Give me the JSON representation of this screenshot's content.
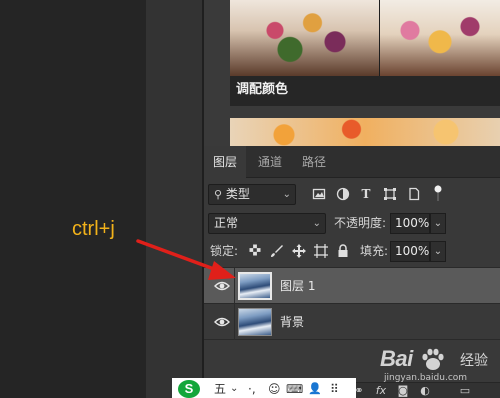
{
  "learn_panel": {
    "card_title": "调配颜色"
  },
  "layers_panel": {
    "tabs": [
      {
        "label": "图层",
        "active": true
      },
      {
        "label": "通道",
        "active": false
      },
      {
        "label": "路径",
        "active": false
      }
    ],
    "filter": {
      "label": "类型",
      "icon": "search-icon",
      "filter_icons": [
        "image-filter-icon",
        "adjustment-filter-icon",
        "type-filter-icon",
        "shape-filter-icon",
        "smart-object-filter-icon"
      ]
    },
    "blend_mode": "正常",
    "opacity": {
      "label": "不透明度:",
      "value": "100%"
    },
    "lock": {
      "label": "锁定:",
      "icons": [
        "lock-transparent-icon",
        "lock-paint-icon",
        "lock-move-icon",
        "lock-artboard-icon",
        "lock-all-icon"
      ]
    },
    "fill": {
      "label": "填充:",
      "value": "100%"
    },
    "layers": [
      {
        "name": "图层 1",
        "selected": true,
        "visible": true
      },
      {
        "name": "背景",
        "selected": false,
        "visible": true
      }
    ],
    "bottom_icons": [
      "link-icon",
      "fx-icon",
      "mask-icon",
      "adjustment-icon",
      "folder-icon"
    ]
  },
  "annotation": {
    "text": "ctrl+j",
    "color": "#f2b21a",
    "arrow_color": "#e0201a"
  },
  "ime_toolbar": {
    "logo": "S",
    "items": [
      "五",
      "⌄",
      "·,",
      "☺",
      "⌨",
      "👤",
      "⠿"
    ]
  },
  "watermark": {
    "brand": "Bai",
    "brand_cn": "经验",
    "url": "jingyan.baidu.com"
  }
}
